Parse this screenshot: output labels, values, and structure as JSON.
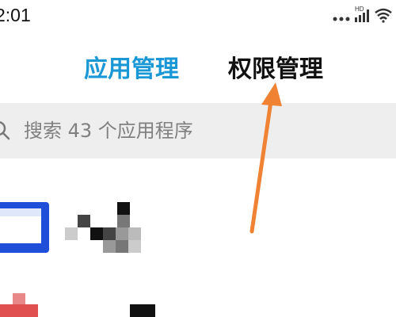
{
  "status_bar": {
    "time": "2:01",
    "network_badge": "HD",
    "icons": [
      "more-dots-icon",
      "signal-icon",
      "wifi-icon"
    ]
  },
  "tabs": [
    {
      "label": "应用管理",
      "active": true
    },
    {
      "label": "权限管理",
      "active": false
    }
  ],
  "search": {
    "placeholder": "搜索 43 个应用程序",
    "icon": "search-icon"
  },
  "apps": [
    {
      "icon": "app-icon",
      "name_obscured": true,
      "accent": "#1f4fd8"
    },
    {
      "icon": "app-icon",
      "name_obscured": true,
      "accent": "#e05050"
    }
  ],
  "annotation": {
    "type": "arrow",
    "color": "#f08234",
    "points_to": "权限管理"
  },
  "colors": {
    "accent": "#1a97d5",
    "search_bg": "#eeeeee",
    "arrow": "#f08234"
  }
}
